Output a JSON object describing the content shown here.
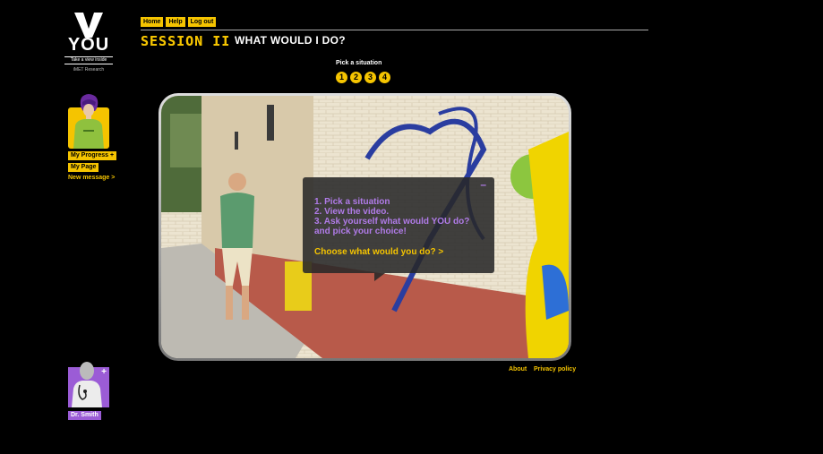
{
  "logo": {
    "letter": "V",
    "word": "YOU",
    "tagline": "Take a view inside",
    "org": "iMET Research"
  },
  "topnav": {
    "home": "Home",
    "help": "Help",
    "logout": "Log out"
  },
  "sidebar": {
    "progress": "My Progress",
    "progress_plus": "+",
    "mypage": "My Page",
    "new_message": "New message >",
    "doctor": "Dr. Smith",
    "doctor_plus": "+"
  },
  "session": {
    "label": "SESSION II",
    "title": "WHAT WOULD I DO?"
  },
  "picker": {
    "label": "Pick a situation",
    "options": [
      "1",
      "2",
      "3",
      "4"
    ]
  },
  "overlay": {
    "minimize": "–",
    "steps": [
      "1. Pick a situation",
      "2. View the video.",
      "3. Ask yourself what would YOU do?",
      "and pick your choice!"
    ],
    "cta": "Choose what would you do? >"
  },
  "footer": {
    "about": "About",
    "privacy": "Privacy policy"
  },
  "colors": {
    "accent": "#f5c400",
    "purple": "#9b5cd6",
    "overlay_text": "#b07be8"
  }
}
